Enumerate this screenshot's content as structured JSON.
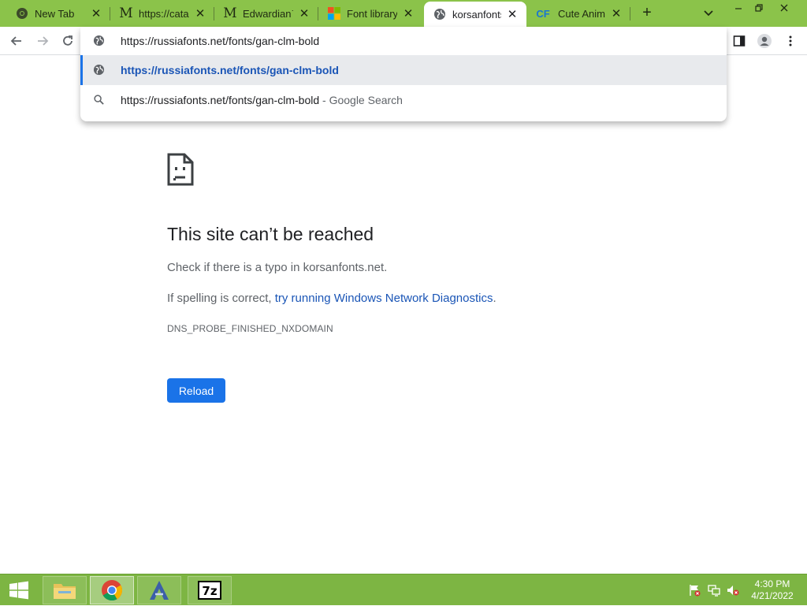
{
  "tabs": [
    {
      "title": "New Tab",
      "favicon": "chrome-icon"
    },
    {
      "title": "https://catal",
      "favicon": "gmail-m-icon"
    },
    {
      "title": "Edwardian™",
      "favicon": "gmail-m-icon"
    },
    {
      "title": "Font library",
      "favicon": "microsoft-logo-icon"
    },
    {
      "title": "korsanfonts.",
      "favicon": "globe-icon",
      "active": true
    },
    {
      "title": "Cute Animal",
      "favicon": "cf-logo-icon"
    }
  ],
  "new_tab_symbol": "+",
  "omnibox": {
    "input_text": "https://russiafonts.net/fonts/gan-clm-bold",
    "suggestions": [
      {
        "text": "https://russiafonts.net/fonts/gan-clm-bold",
        "suffix": "",
        "icon": "globe-icon",
        "selected": true
      },
      {
        "text": "https://russiafonts.net/fonts/gan-clm-bold",
        "suffix": " - Google Search",
        "icon": "search-icon",
        "selected": false
      }
    ]
  },
  "error_page": {
    "title": "This site can’t be reached",
    "line1": "Check if there is a typo in korsanfonts.net.",
    "line2_prefix": "If spelling is correct, ",
    "line2_link": "try running Windows Network Diagnostics",
    "line2_suffix": ".",
    "error_code": "DNS_PROBE_FINISHED_NXDOMAIN",
    "reload_label": "Reload"
  },
  "taskbar": {
    "apps": [
      "file-explorer-icon",
      "chrome-icon",
      "app-a-icon",
      "7zip-icon"
    ],
    "clock_time": "4:30 PM",
    "clock_date": "4/21/2022"
  },
  "colors": {
    "tabstrip": "#8bc34a",
    "taskbar": "#7db543",
    "accent": "#1a73e8",
    "link": "#1a55b6"
  }
}
